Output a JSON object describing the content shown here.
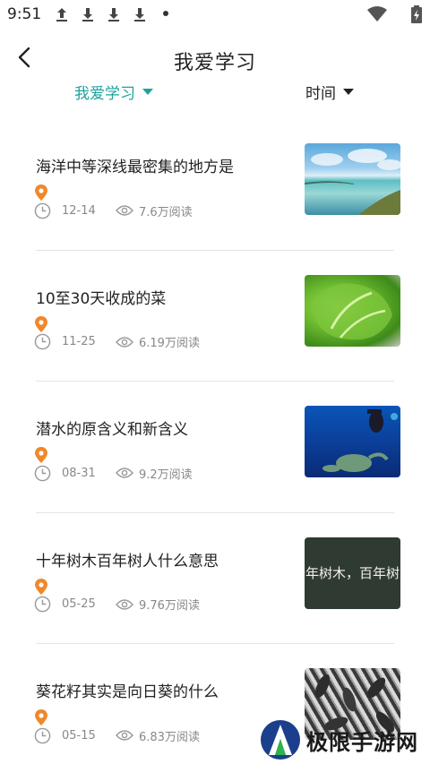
{
  "status_bar": {
    "time": "9:51",
    "icons": [
      "upload-icon",
      "download-icon",
      "download-icon",
      "download-icon",
      "dot-icon",
      "wifi-icon",
      "battery-icon"
    ]
  },
  "header": {
    "title": "我爱学习",
    "back_icon": "chevron-left-icon"
  },
  "filters": [
    {
      "label": "我爱学习",
      "active": true,
      "color": "#1ea39c"
    },
    {
      "label": "时间",
      "active": false,
      "color": "#222222"
    }
  ],
  "articles": [
    {
      "title": "海洋中等深线最密集的地方是",
      "date": "12-14",
      "views": "7.6万阅读",
      "thumbnail": "ocean-coast-photo"
    },
    {
      "title": "10至30天收成的菜",
      "date": "11-25",
      "views": "6.19万阅读",
      "thumbnail": "lettuce-photo"
    },
    {
      "title": "潜水的原含义和新含义",
      "date": "08-31",
      "views": "9.2万阅读",
      "thumbnail": "diver-sea-turtle-photo"
    },
    {
      "title": "十年树木百年树人什么意思",
      "date": "05-25",
      "views": "9.76万阅读",
      "thumbnail": "blackboard-text",
      "thumbnail_text": "十年树木，百年树人"
    },
    {
      "title": "葵花籽其实是向日葵的什么",
      "date": "05-15",
      "views": "6.83万阅读",
      "thumbnail": "sunflower-seeds-photo"
    }
  ],
  "watermark": {
    "text": "极限手游网"
  },
  "colors": {
    "accent": "#1ea39c",
    "pin": "#f0882a",
    "meta": "#888888"
  }
}
